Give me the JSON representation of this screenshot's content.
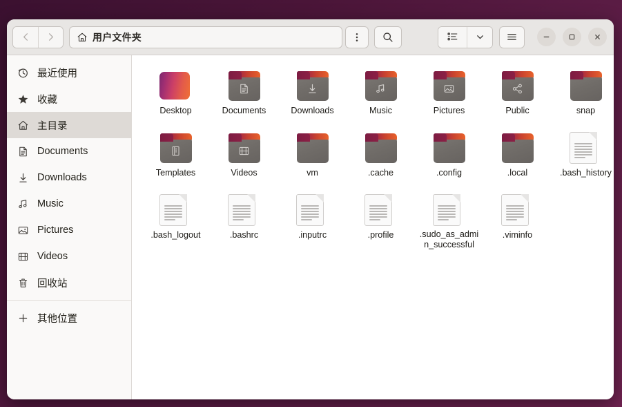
{
  "window": {
    "title": "用户文件夹"
  },
  "toolbar": {
    "back_tooltip": "后退",
    "forward_tooltip": "前进",
    "path_label": "用户文件夹",
    "path_icon": "home-icon",
    "menu_icon": "vertical-dots-icon",
    "search_icon": "search-icon",
    "view_list_icon": "list-view-icon",
    "view_dropdown_icon": "chevron-down-icon",
    "hamburger_icon": "hamburger-menu-icon",
    "minimize_label": "—",
    "maximize_label": "□",
    "close_label": "✕"
  },
  "sidebar": {
    "items": [
      {
        "label": "最近使用",
        "icon": "clock-icon",
        "selected": false
      },
      {
        "label": "收藏",
        "icon": "star-icon",
        "selected": false
      },
      {
        "label": "主目录",
        "icon": "home-icon",
        "selected": true
      },
      {
        "label": "Documents",
        "icon": "document-icon",
        "selected": false
      },
      {
        "label": "Downloads",
        "icon": "download-icon",
        "selected": false
      },
      {
        "label": "Music",
        "icon": "music-note-icon",
        "selected": false
      },
      {
        "label": "Pictures",
        "icon": "image-icon",
        "selected": false
      },
      {
        "label": "Videos",
        "icon": "film-icon",
        "selected": false
      },
      {
        "label": "回收站",
        "icon": "trash-icon",
        "selected": false
      }
    ],
    "other_locations": {
      "label": "其他位置",
      "icon": "plus-icon"
    }
  },
  "files": [
    {
      "name": "Desktop",
      "type": "desktop"
    },
    {
      "name": "Documents",
      "type": "folder",
      "emblem": "document-icon"
    },
    {
      "name": "Downloads",
      "type": "folder",
      "emblem": "download-icon"
    },
    {
      "name": "Music",
      "type": "folder",
      "emblem": "music-note-icon"
    },
    {
      "name": "Pictures",
      "type": "folder",
      "emblem": "image-icon"
    },
    {
      "name": "Public",
      "type": "folder",
      "emblem": "share-icon"
    },
    {
      "name": "snap",
      "type": "folder",
      "emblem": ""
    },
    {
      "name": "Templates",
      "type": "folder",
      "emblem": "template-icon"
    },
    {
      "name": "Videos",
      "type": "folder",
      "emblem": "film-icon"
    },
    {
      "name": "vm",
      "type": "folder",
      "emblem": ""
    },
    {
      "name": ".cache",
      "type": "folder",
      "emblem": ""
    },
    {
      "name": ".config",
      "type": "folder",
      "emblem": ""
    },
    {
      "name": ".local",
      "type": "folder",
      "emblem": ""
    },
    {
      "name": ".bash_history",
      "type": "text"
    },
    {
      "name": ".bash_logout",
      "type": "text"
    },
    {
      "name": ".bashrc",
      "type": "text"
    },
    {
      "name": ".inputrc",
      "type": "text"
    },
    {
      "name": ".profile",
      "type": "text"
    },
    {
      "name": ".sudo_as_admin_successful",
      "type": "text"
    },
    {
      "name": ".viminfo",
      "type": "text"
    }
  ],
  "colors": {
    "desktop_bg": "#4a1538",
    "headerbar": "#e8e6e4",
    "sidebar_bg": "#faf9f8",
    "sidebar_selected": "#dedad6",
    "folder_tab_start": "#7d1c42",
    "folder_tab_end": "#e8622b",
    "folder_body": "#706c68"
  }
}
